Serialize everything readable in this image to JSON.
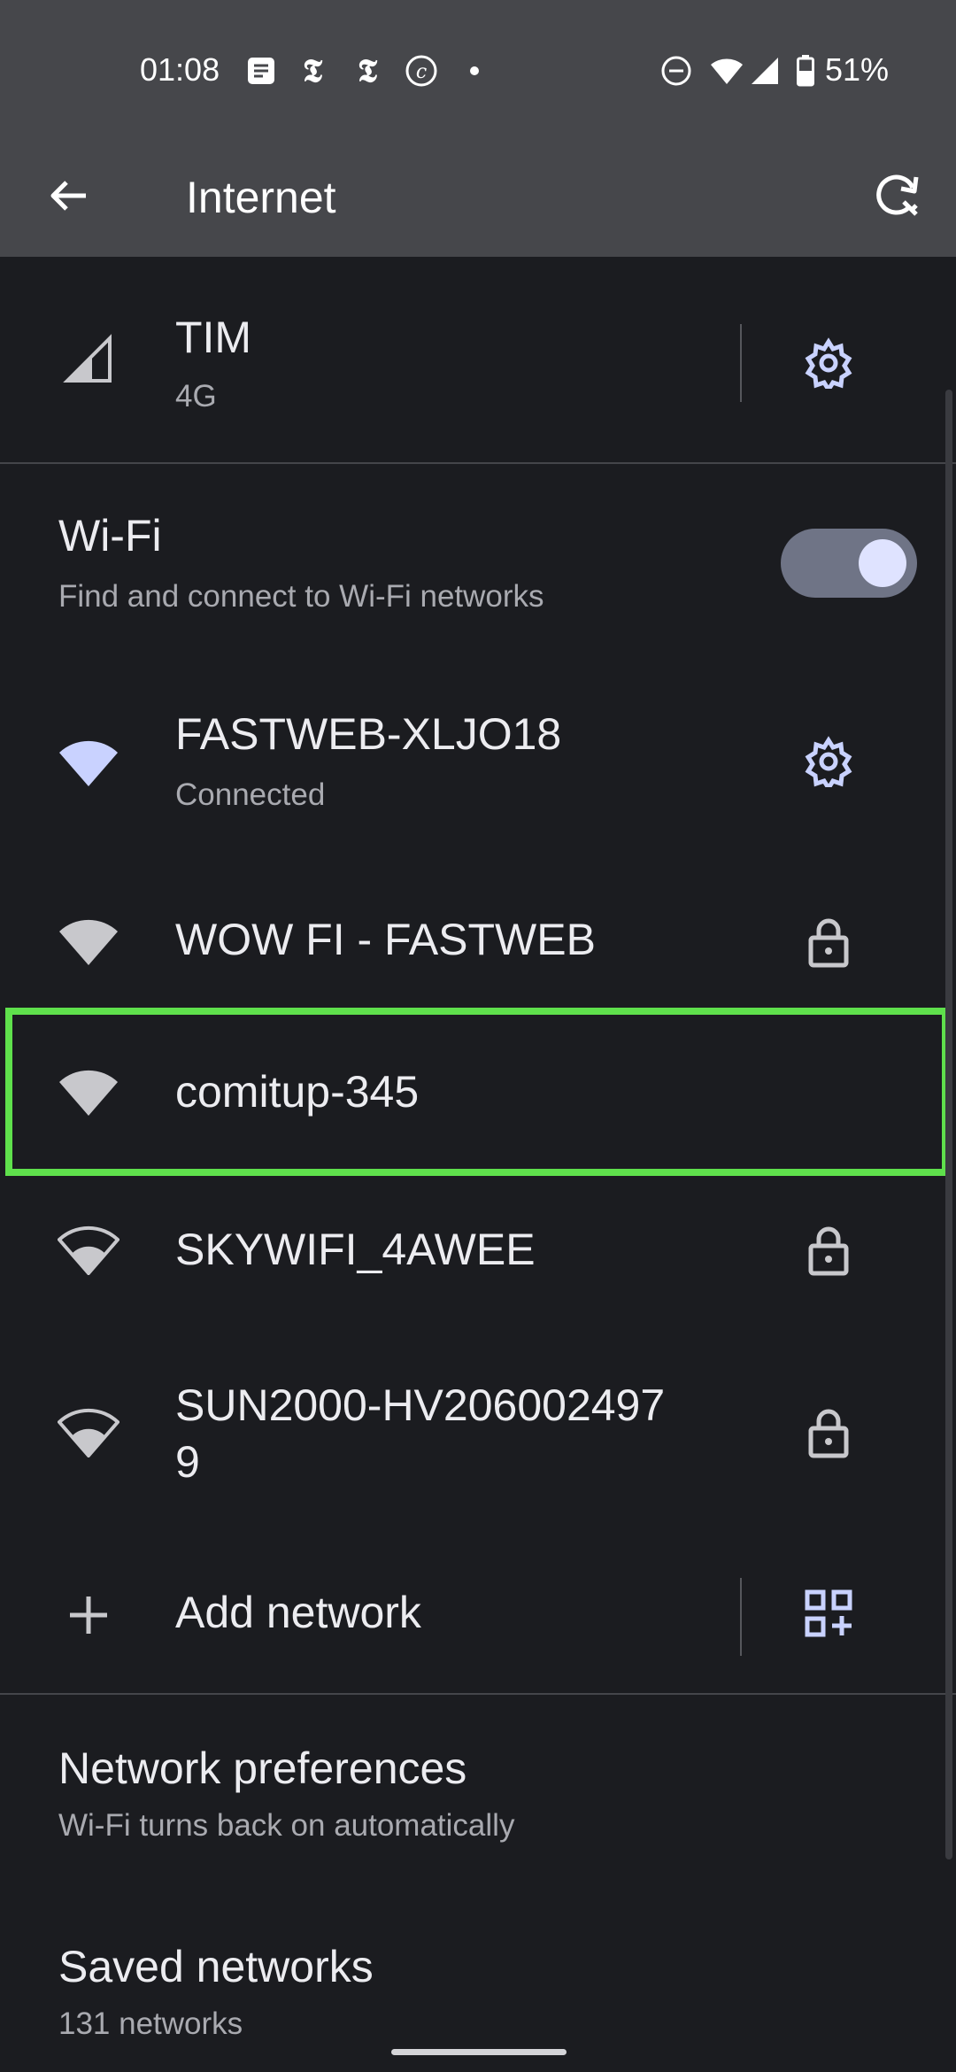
{
  "status_bar": {
    "time": "01:08",
    "battery_percent": "51%",
    "icons": [
      "notification-icon",
      "nyt-icon",
      "nyt-icon",
      "c-icon",
      "dot-icon",
      "dnd-icon",
      "wifi-icon",
      "signal-icon",
      "battery-icon"
    ]
  },
  "app_bar": {
    "title": "Internet"
  },
  "mobile": {
    "carrier": "TIM",
    "network_type": "4G"
  },
  "wifi": {
    "title": "Wi-Fi",
    "subtitle": "Find and connect to Wi-Fi networks",
    "enabled": true
  },
  "networks": [
    {
      "name": "FASTWEB-XLJO18",
      "status": "Connected",
      "trailing": "settings",
      "signal": "full"
    },
    {
      "name": "WOW FI - FASTWEB",
      "trailing": "lock",
      "signal": "full"
    },
    {
      "name": "comitup-345",
      "trailing": "none",
      "signal": "full"
    },
    {
      "name": "SKYWIFI_4AWEE",
      "trailing": "lock",
      "signal": "medium"
    },
    {
      "name_line1": "SUN2000-HV206002497",
      "name_line2": "9",
      "trailing": "lock",
      "signal": "medium"
    }
  ],
  "add_network": {
    "label": "Add network"
  },
  "preferences": {
    "title": "Network preferences",
    "subtitle": "Wi-Fi turns back on automatically"
  },
  "saved": {
    "title": "Saved networks",
    "subtitle": "131 networks"
  },
  "colors": {
    "background": "#1b1c20",
    "header": "#46474b",
    "accent_icon": "#c9d2ff",
    "highlight": "#5fe04c"
  }
}
